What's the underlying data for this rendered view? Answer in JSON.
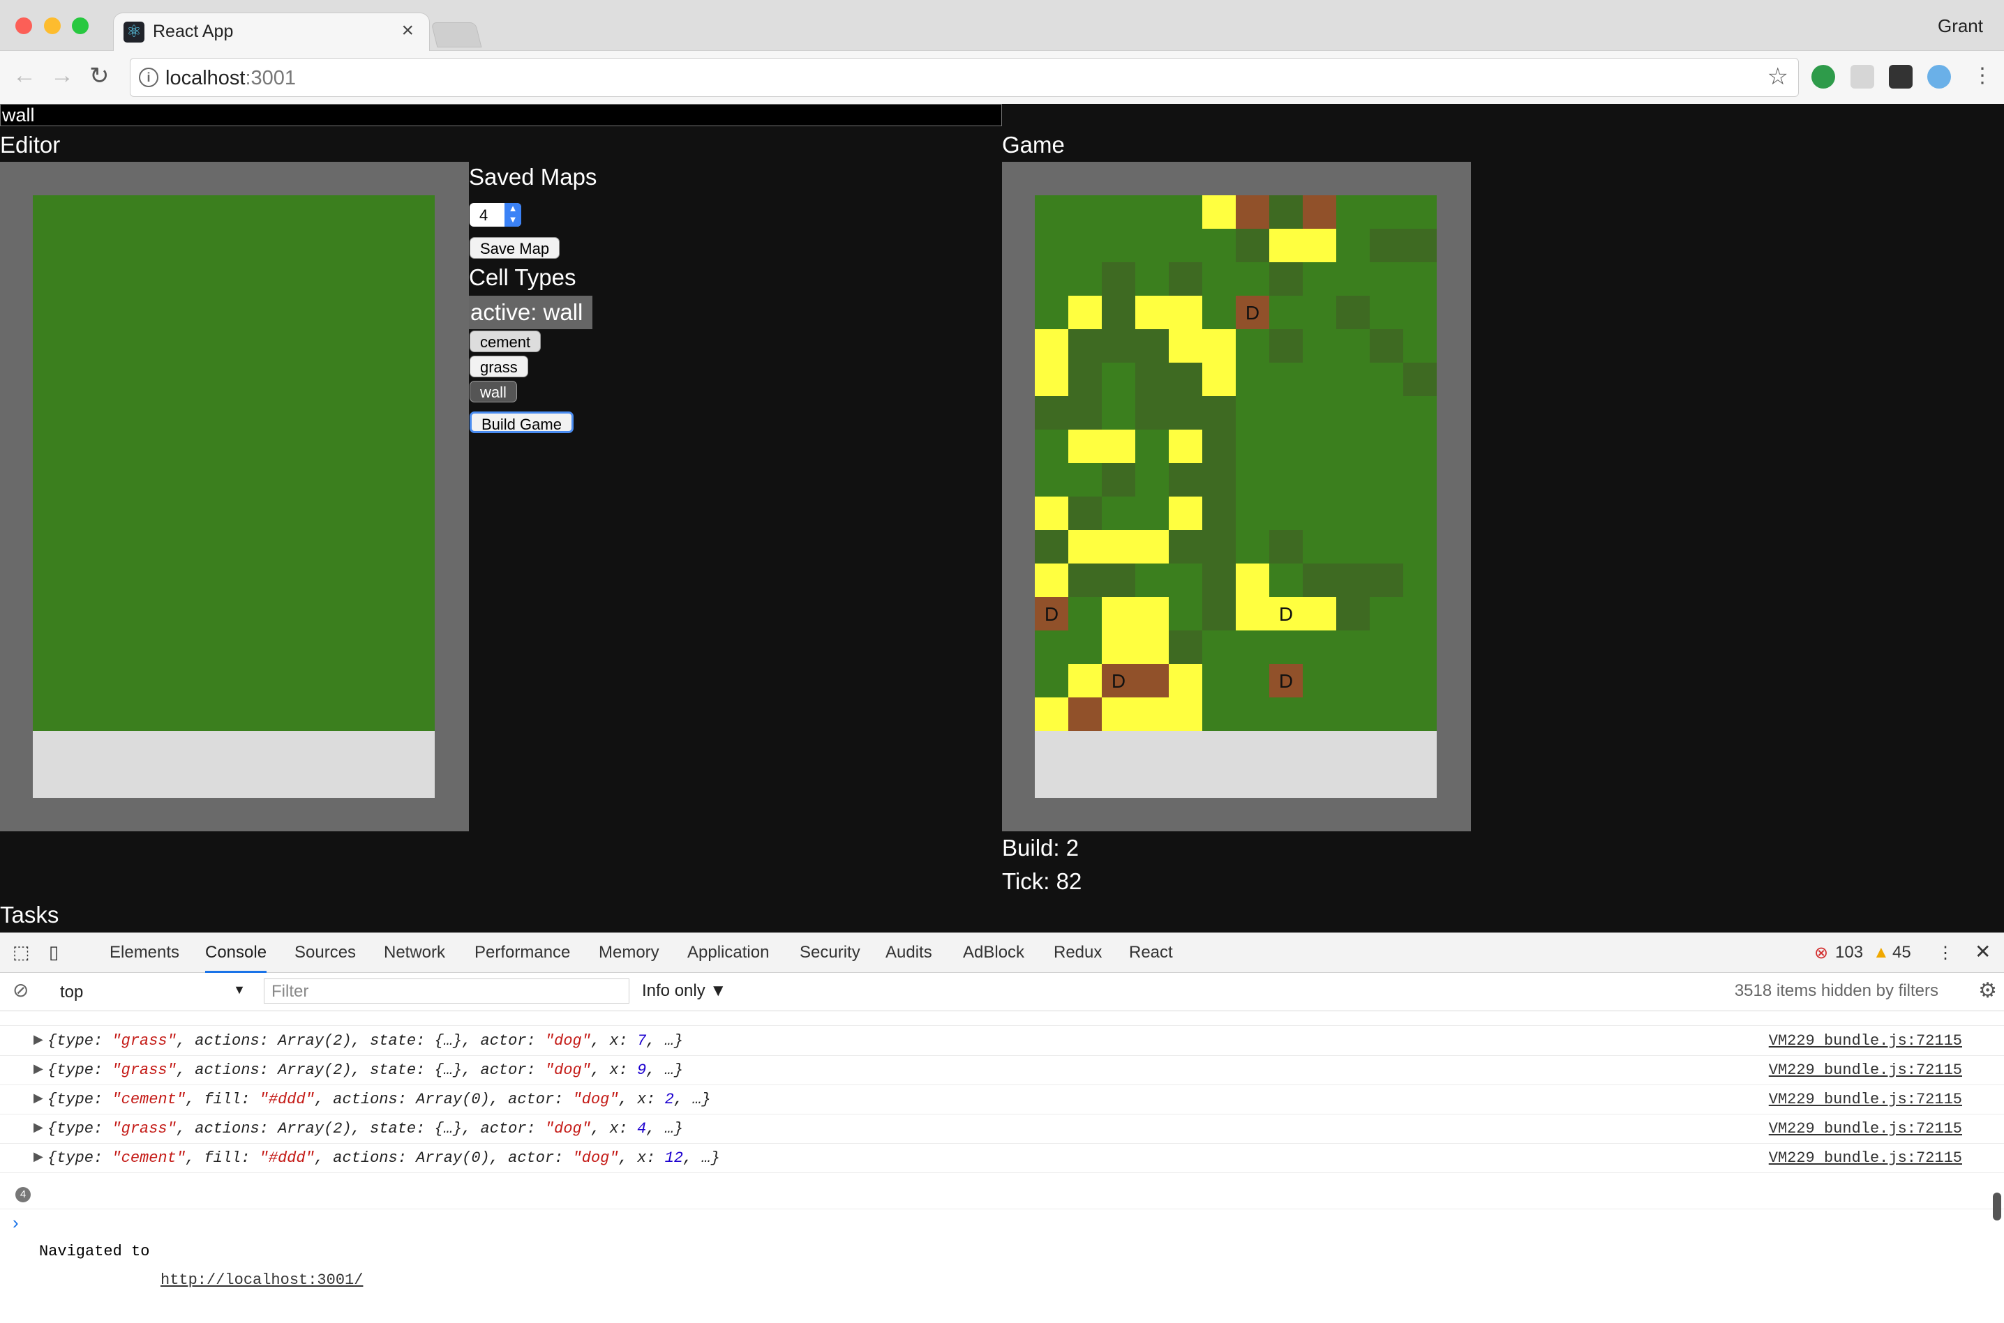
{
  "browser": {
    "tab_title": "React App",
    "tab_close": "×",
    "user": "Grant",
    "url_host": "localhost",
    "url_port": ":3001",
    "back_icon": "arrow-left-icon",
    "forward_icon": "arrow-right-icon",
    "reload_icon": "reload-icon"
  },
  "app": {
    "tool_input_value": "wall",
    "editor_title": "Editor",
    "game_title": "Game",
    "saved_maps_title": "Saved Maps",
    "map_select_value": "4",
    "save_map_label": "Save Map",
    "cell_types_title": "Cell Types",
    "active_label": "active: wall",
    "cell_types": [
      "cement",
      "grass",
      "wall"
    ],
    "build_game_label": "Build Game",
    "build_label": "Build: 2",
    "tick_label": "Tick: 82",
    "tasks_title": "Tasks",
    "colors": {
      "grass": "#3b7f1e",
      "dark_grass": "#3e6a22",
      "wall": "#ffff40",
      "dirt": "#91512a",
      "cement": "#dcdcdc",
      "frame": "#6a6a6a"
    },
    "game_grid": {
      "cols": 12,
      "rows": 16,
      "cells": [
        "GGGGGWDdDGGG",
        "GGGGGGdWWGdd",
        "GGdGdGGdGGGG",
        "GWdWWGDGGdGG",
        "WdddWWGdGGdG",
        "WdGddWGGGGGd",
        "ddGdddGGGGGG",
        "GWWGWdGGGGGG",
        "GGdGddGGGGGG",
        "WdGGWdGGGGGG",
        "dWWWddGdGGGG",
        "WddGGdWGdddG",
        "DGWWGdWWWdGG",
        "GGWWdGGGGGGG",
        "GWDDWGGDGGGG",
        "WDWWWGGGGGGG"
      ],
      "dog_markers": [
        "D",
        "D",
        "D",
        "D",
        "D"
      ]
    }
  },
  "devtools": {
    "tabs": [
      "Elements",
      "Console",
      "Sources",
      "Network",
      "Performance",
      "Memory",
      "Application",
      "Security",
      "Audits",
      "AdBlock",
      "Redux",
      "React"
    ],
    "active_tab": "Console",
    "error_count": "103",
    "warning_count": "45",
    "context": "top",
    "filter_placeholder": "Filter",
    "levels": "Info only",
    "hidden_count": "3518 items hidden by filters",
    "logs": [
      {
        "parts": [
          [
            "{type: ",
            "k"
          ],
          [
            "\"grass\"",
            "s"
          ],
          [
            ", actions: Array(2), state: {…}, actor: ",
            "k"
          ],
          [
            "\"dog\"",
            "s"
          ],
          [
            ", x: ",
            "k"
          ],
          [
            "7",
            "n"
          ],
          [
            ", …}",
            "k"
          ]
        ],
        "src": "VM229 bundle.js:72115"
      },
      {
        "parts": [
          [
            "{type: ",
            "k"
          ],
          [
            "\"grass\"",
            "s"
          ],
          [
            ", actions: Array(2), state: {…}, actor: ",
            "k"
          ],
          [
            "\"dog\"",
            "s"
          ],
          [
            ", x: ",
            "k"
          ],
          [
            "9",
            "n"
          ],
          [
            ", …}",
            "k"
          ]
        ],
        "src": "VM229 bundle.js:72115"
      },
      {
        "parts": [
          [
            "{type: ",
            "k"
          ],
          [
            "\"cement\"",
            "s"
          ],
          [
            ", fill: ",
            "k"
          ],
          [
            "\"#ddd\"",
            "s"
          ],
          [
            ", actions: Array(0), actor: ",
            "k"
          ],
          [
            "\"dog\"",
            "s"
          ],
          [
            ", x: ",
            "k"
          ],
          [
            "2",
            "n"
          ],
          [
            ", …}",
            "k"
          ]
        ],
        "src": "VM229 bundle.js:72115"
      },
      {
        "parts": [
          [
            "{type: ",
            "k"
          ],
          [
            "\"grass\"",
            "s"
          ],
          [
            ", actions: Array(2), state: {…}, actor: ",
            "k"
          ],
          [
            "\"dog\"",
            "s"
          ],
          [
            ", x: ",
            "k"
          ],
          [
            "4",
            "n"
          ],
          [
            ", …}",
            "k"
          ]
        ],
        "src": "VM229 bundle.js:72115"
      },
      {
        "parts": [
          [
            "{type: ",
            "k"
          ],
          [
            "\"cement\"",
            "s"
          ],
          [
            ", fill: ",
            "k"
          ],
          [
            "\"#ddd\"",
            "s"
          ],
          [
            ", actions: Array(0), actor: ",
            "k"
          ],
          [
            "\"dog\"",
            "s"
          ],
          [
            ", x: ",
            "k"
          ],
          [
            "12",
            "n"
          ],
          [
            ", …}",
            "k"
          ]
        ],
        "src": "VM229 bundle.js:72115"
      }
    ],
    "nav_count": "4",
    "nav_text": "Navigated to ",
    "nav_link": "http://localhost:3001/",
    "prompt": "›"
  }
}
